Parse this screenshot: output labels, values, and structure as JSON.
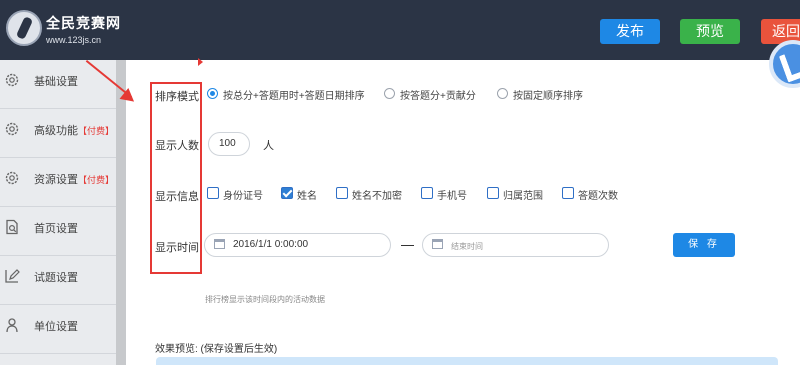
{
  "header": {
    "logo_title": "全民竞赛网",
    "logo_url": "www.123js.cn",
    "publish_label": "发布",
    "preview_label": "预览",
    "back_label": "返回"
  },
  "sidebar": {
    "items": [
      {
        "label": "基础设置",
        "icon": "gear-icon"
      },
      {
        "label": "高级功能",
        "tag": "【付费】",
        "icon": "gear-icon"
      },
      {
        "label": "资源设置",
        "tag": "【付费】",
        "icon": "gear-icon"
      },
      {
        "label": "首页设置",
        "icon": "document-search-icon"
      },
      {
        "label": "试题设置",
        "icon": "edit-icon"
      },
      {
        "label": "单位设置",
        "icon": "user-icon"
      }
    ]
  },
  "form": {
    "sort_mode": {
      "label": "排序模式:",
      "options": [
        "按总分+答题用时+答题日期排序",
        "按答题分+贡献分",
        "按固定顺序排序"
      ],
      "selected": 0
    },
    "display_count": {
      "label": "显示人数:",
      "value": "100",
      "unit": "人"
    },
    "display_info": {
      "label": "显示信息:",
      "options": [
        {
          "label": "身份证号",
          "checked": false
        },
        {
          "label": "姓名",
          "checked": true
        },
        {
          "label": "姓名不加密",
          "checked": false
        },
        {
          "label": "手机号",
          "checked": false
        },
        {
          "label": "归属范围",
          "checked": false
        },
        {
          "label": "答题次数",
          "checked": false
        }
      ]
    },
    "display_time": {
      "label": "显示时间:",
      "start_value": "2016/1/1 0:00:00",
      "end_placeholder": "结束时间"
    },
    "save_label": "保 存",
    "hint": "排行榜显示该时间段内的活动数据",
    "preview_label": "效果预览:  (保存设置后生效)"
  },
  "colors": {
    "header_bg": "#2b3445",
    "publish": "#1e88e5",
    "preview": "#3ab24a",
    "back": "#e9533c",
    "annotation": "#e53935"
  }
}
